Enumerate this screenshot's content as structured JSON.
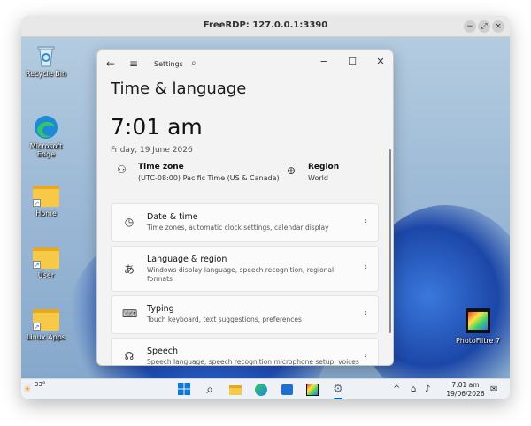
{
  "rdp": {
    "title": "FreeRDP: 127.0.0.1:3390",
    "min": "−",
    "restore": "⤢",
    "close": "×"
  },
  "desktop": {
    "icons": [
      {
        "label": "Recycle Bin"
      },
      {
        "label": "Microsoft Edge"
      },
      {
        "label": "Home"
      },
      {
        "label": "User"
      },
      {
        "label": "Linux Apps"
      },
      {
        "label": "PhotoFiltre 7"
      }
    ]
  },
  "settings": {
    "app_name": "Settings",
    "page_title": "Time & language",
    "time": "7:01 am",
    "date": "Friday, 19 June 2026",
    "time_zone": {
      "title": "Time zone",
      "value": "(UTC-08:00) Pacific Time (US & Canada)"
    },
    "region": {
      "title": "Region",
      "value": "World"
    },
    "cards": [
      {
        "title": "Date & time",
        "desc": "Time zones, automatic clock settings, calendar display",
        "icon": "date-time-icon"
      },
      {
        "title": "Language & region",
        "desc": "Windows display language, speech recognition, regional formats",
        "icon": "language-icon"
      },
      {
        "title": "Typing",
        "desc": "Touch keyboard, text suggestions, preferences",
        "icon": "keyboard-icon"
      },
      {
        "title": "Speech",
        "desc": "Speech language, speech recognition microphone setup, voices",
        "icon": "speech-icon"
      }
    ]
  },
  "taskbar": {
    "weather": "33°",
    "time": "7:01 am",
    "date": "19/06/2026"
  },
  "colors": {
    "accent": "#0067c0",
    "folder": "#f7c948",
    "desktop": "#9dbad6"
  }
}
